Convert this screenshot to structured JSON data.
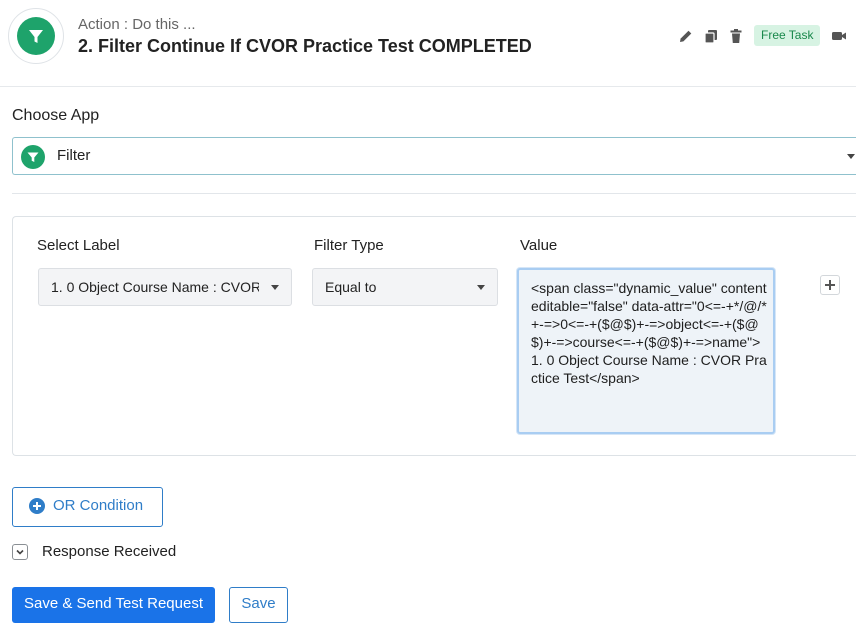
{
  "header": {
    "subtitle": "Action : Do this ...",
    "title": "2. Filter Continue If CVOR Practice Test COMPLETED",
    "badge": "Free Task",
    "icons": [
      "pencil-icon",
      "copy-icon",
      "trash-icon",
      "video-icon"
    ],
    "app_icon": "filter-icon",
    "accent_color": "#1ea36b"
  },
  "choose_app": {
    "label": "Choose App",
    "selected": "Filter"
  },
  "filter": {
    "columns": {
      "select_label": "Select Label",
      "filter_type": "Filter Type",
      "value": "Value"
    },
    "row": {
      "label_value": "1. 0 Object Course Name : CVOR Practice Test",
      "filter_type_value": "Equal to",
      "value": "<span class=\"dynamic_value\" contenteditable=\"false\" data-attr=\"0<=-+*/@/*+-=>0<=-+($@$)+-=>object<=-+($@$)+-=>course<=-+($@$)+-=>name\">1. 0 Object Course Name : CVOR Practice Test</span>"
    }
  },
  "or_condition": {
    "label": "OR Condition"
  },
  "response": {
    "label": "Response Received"
  },
  "buttons": {
    "send_test": "Save & Send Test Request",
    "save": "Save"
  },
  "colors": {
    "primary": "#1a73e8",
    "link": "#2f7dc8",
    "badge_bg": "#d7f3e3",
    "badge_text": "#19884b"
  }
}
